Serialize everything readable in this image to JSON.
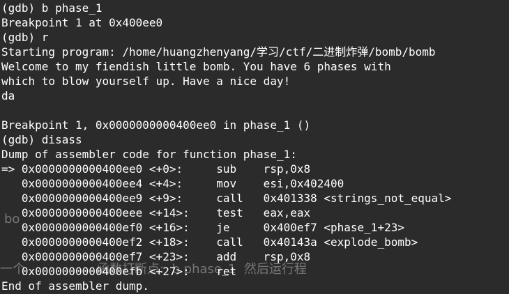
{
  "terminal": {
    "lines": [
      "(gdb) b phase_1",
      "Breakpoint 1 at 0x400ee0",
      "(gdb) r",
      "Starting program: /home/huangzhenyang/学习/ctf/二进制炸弹/bomb/bomb",
      "Welcome to my fiendish little bomb. You have 6 phases with",
      "which to blow yourself up. Have a nice day!",
      "da",
      "",
      "Breakpoint 1, 0x0000000000400ee0 in phase_1 ()",
      "(gdb) disass",
      "Dump of assembler code for function phase_1:",
      "=> 0x0000000000400ee0 <+0>:     sub    rsp,0x8",
      "   0x0000000000400ee4 <+4>:     mov    esi,0x402400",
      "   0x0000000000400ee9 <+9>:     call   0x401338 <strings_not_equal>",
      "   0x0000000000400eee <+14>:    test   eax,eax",
      "   0x0000000000400ef0 <+16>:    je     0x400ef7 <phase_1+23>",
      "   0x0000000000400ef2 <+18>:    call   0x40143a <explode_bomb>",
      "   0x0000000000400ef7 <+23>:    add    rsp,0x8",
      "   0x0000000000400efb <+27>:    ret",
      "End of assembler dump."
    ]
  },
  "watermark": {
    "line1": "bo",
    "line2": "一个                  函数打断点:  b phase_1  然后运行程"
  }
}
